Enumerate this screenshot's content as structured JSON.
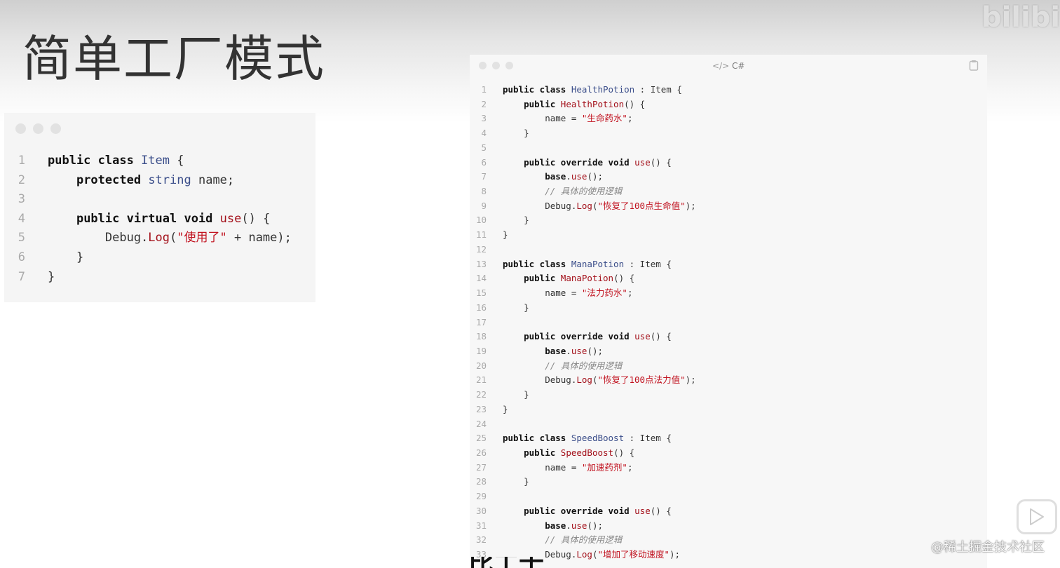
{
  "slide": {
    "title": "简单工厂模式",
    "watermark_top": "bilibili",
    "watermark_bottom": "@稀土掘金技术社区",
    "bottom_text": "比工士"
  },
  "left_code": {
    "lines": [
      {
        "n": "1",
        "tokens": [
          {
            "t": "public class ",
            "c": "kw"
          },
          {
            "t": "Item",
            "c": "cls"
          },
          {
            "t": " {",
            "c": ""
          }
        ]
      },
      {
        "n": "2",
        "tokens": [
          {
            "t": "    ",
            "c": ""
          },
          {
            "t": "protected ",
            "c": "kw"
          },
          {
            "t": "string",
            "c": "typ"
          },
          {
            "t": " name;",
            "c": ""
          }
        ]
      },
      {
        "n": "3",
        "tokens": []
      },
      {
        "n": "4",
        "tokens": [
          {
            "t": "    ",
            "c": ""
          },
          {
            "t": "public virtual void ",
            "c": "kw"
          },
          {
            "t": "use",
            "c": "fn"
          },
          {
            "t": "() {",
            "c": ""
          }
        ]
      },
      {
        "n": "5",
        "tokens": [
          {
            "t": "        Debug.",
            "c": ""
          },
          {
            "t": "Log",
            "c": "fn"
          },
          {
            "t": "(",
            "c": ""
          },
          {
            "t": "\"使用了\"",
            "c": "str"
          },
          {
            "t": " + name);",
            "c": ""
          }
        ]
      },
      {
        "n": "6",
        "tokens": [
          {
            "t": "    }",
            "c": ""
          }
        ]
      },
      {
        "n": "7",
        "tokens": [
          {
            "t": "}",
            "c": ""
          }
        ]
      }
    ]
  },
  "right_code": {
    "language": "C#",
    "lines": [
      {
        "n": "1",
        "tokens": [
          {
            "t": "public class ",
            "c": "kw"
          },
          {
            "t": "HealthPotion",
            "c": "cls"
          },
          {
            "t": " : Item {",
            "c": ""
          }
        ]
      },
      {
        "n": "2",
        "tokens": [
          {
            "t": "    ",
            "c": ""
          },
          {
            "t": "public ",
            "c": "kw"
          },
          {
            "t": "HealthPotion",
            "c": "fn"
          },
          {
            "t": "() {",
            "c": ""
          }
        ]
      },
      {
        "n": "3",
        "tokens": [
          {
            "t": "        name = ",
            "c": ""
          },
          {
            "t": "\"生命药水\"",
            "c": "str"
          },
          {
            "t": ";",
            "c": ""
          }
        ]
      },
      {
        "n": "4",
        "tokens": [
          {
            "t": "    }",
            "c": ""
          }
        ]
      },
      {
        "n": "5",
        "tokens": []
      },
      {
        "n": "6",
        "tokens": [
          {
            "t": "    ",
            "c": ""
          },
          {
            "t": "public override void ",
            "c": "kw"
          },
          {
            "t": "use",
            "c": "fn"
          },
          {
            "t": "() {",
            "c": ""
          }
        ]
      },
      {
        "n": "7",
        "tokens": [
          {
            "t": "        ",
            "c": ""
          },
          {
            "t": "base",
            "c": "kw"
          },
          {
            "t": ".",
            "c": ""
          },
          {
            "t": "use",
            "c": "fn"
          },
          {
            "t": "();",
            "c": ""
          }
        ]
      },
      {
        "n": "8",
        "tokens": [
          {
            "t": "        ",
            "c": ""
          },
          {
            "t": "// 具体的使用逻辑",
            "c": "cmt"
          }
        ]
      },
      {
        "n": "9",
        "tokens": [
          {
            "t": "        Debug.",
            "c": ""
          },
          {
            "t": "Log",
            "c": "fn"
          },
          {
            "t": "(",
            "c": ""
          },
          {
            "t": "\"恢复了100点生命值\"",
            "c": "str"
          },
          {
            "t": ");",
            "c": ""
          }
        ]
      },
      {
        "n": "10",
        "tokens": [
          {
            "t": "    }",
            "c": ""
          }
        ]
      },
      {
        "n": "11",
        "tokens": [
          {
            "t": "}",
            "c": ""
          }
        ]
      },
      {
        "n": "12",
        "tokens": []
      },
      {
        "n": "13",
        "tokens": [
          {
            "t": "public class ",
            "c": "kw"
          },
          {
            "t": "ManaPotion",
            "c": "cls"
          },
          {
            "t": " : Item {",
            "c": ""
          }
        ]
      },
      {
        "n": "14",
        "tokens": [
          {
            "t": "    ",
            "c": ""
          },
          {
            "t": "public ",
            "c": "kw"
          },
          {
            "t": "ManaPotion",
            "c": "fn"
          },
          {
            "t": "() {",
            "c": ""
          }
        ]
      },
      {
        "n": "15",
        "tokens": [
          {
            "t": "        name = ",
            "c": ""
          },
          {
            "t": "\"法力药水\"",
            "c": "str"
          },
          {
            "t": ";",
            "c": ""
          }
        ]
      },
      {
        "n": "16",
        "tokens": [
          {
            "t": "    }",
            "c": ""
          }
        ]
      },
      {
        "n": "17",
        "tokens": []
      },
      {
        "n": "18",
        "tokens": [
          {
            "t": "    ",
            "c": ""
          },
          {
            "t": "public override void ",
            "c": "kw"
          },
          {
            "t": "use",
            "c": "fn"
          },
          {
            "t": "() {",
            "c": ""
          }
        ]
      },
      {
        "n": "19",
        "tokens": [
          {
            "t": "        ",
            "c": ""
          },
          {
            "t": "base",
            "c": "kw"
          },
          {
            "t": ".",
            "c": ""
          },
          {
            "t": "use",
            "c": "fn"
          },
          {
            "t": "();",
            "c": ""
          }
        ]
      },
      {
        "n": "20",
        "tokens": [
          {
            "t": "        ",
            "c": ""
          },
          {
            "t": "// 具体的使用逻辑",
            "c": "cmt"
          }
        ]
      },
      {
        "n": "21",
        "tokens": [
          {
            "t": "        Debug.",
            "c": ""
          },
          {
            "t": "Log",
            "c": "fn"
          },
          {
            "t": "(",
            "c": ""
          },
          {
            "t": "\"恢复了100点法力值\"",
            "c": "str"
          },
          {
            "t": ");",
            "c": ""
          }
        ]
      },
      {
        "n": "22",
        "tokens": [
          {
            "t": "    }",
            "c": ""
          }
        ]
      },
      {
        "n": "23",
        "tokens": [
          {
            "t": "}",
            "c": ""
          }
        ]
      },
      {
        "n": "24",
        "tokens": []
      },
      {
        "n": "25",
        "tokens": [
          {
            "t": "public class ",
            "c": "kw"
          },
          {
            "t": "SpeedBoost",
            "c": "cls"
          },
          {
            "t": " : Item {",
            "c": ""
          }
        ]
      },
      {
        "n": "26",
        "tokens": [
          {
            "t": "    ",
            "c": ""
          },
          {
            "t": "public ",
            "c": "kw"
          },
          {
            "t": "SpeedBoost",
            "c": "fn"
          },
          {
            "t": "() {",
            "c": ""
          }
        ]
      },
      {
        "n": "27",
        "tokens": [
          {
            "t": "        name = ",
            "c": ""
          },
          {
            "t": "\"加速药剂\"",
            "c": "str"
          },
          {
            "t": ";",
            "c": ""
          }
        ]
      },
      {
        "n": "28",
        "tokens": [
          {
            "t": "    }",
            "c": ""
          }
        ]
      },
      {
        "n": "29",
        "tokens": []
      },
      {
        "n": "30",
        "tokens": [
          {
            "t": "    ",
            "c": ""
          },
          {
            "t": "public override void ",
            "c": "kw"
          },
          {
            "t": "use",
            "c": "fn"
          },
          {
            "t": "() {",
            "c": ""
          }
        ]
      },
      {
        "n": "31",
        "tokens": [
          {
            "t": "        ",
            "c": ""
          },
          {
            "t": "base",
            "c": "kw"
          },
          {
            "t": ".",
            "c": ""
          },
          {
            "t": "use",
            "c": "fn"
          },
          {
            "t": "();",
            "c": ""
          }
        ]
      },
      {
        "n": "32",
        "tokens": [
          {
            "t": "        ",
            "c": ""
          },
          {
            "t": "// 具体的使用逻辑",
            "c": "cmt"
          }
        ]
      },
      {
        "n": "33",
        "tokens": [
          {
            "t": "        Debug.",
            "c": ""
          },
          {
            "t": "Log",
            "c": "fn"
          },
          {
            "t": "(",
            "c": ""
          },
          {
            "t": "\"增加了移动速度\"",
            "c": "str"
          },
          {
            "t": ");",
            "c": ""
          }
        ]
      }
    ]
  },
  "icons": {
    "code_icon": "code-brackets-icon",
    "copy_icon": "clipboard-icon",
    "play_icon": "play-icon"
  }
}
